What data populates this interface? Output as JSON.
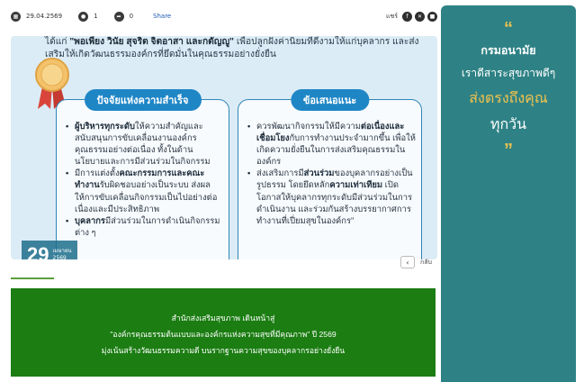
{
  "meta": {
    "date": "29.04.2569",
    "comments": "1",
    "shares": "0",
    "share_label": "Share",
    "share_right_label": "แชร์"
  },
  "infographic": {
    "title_prefix": "ได้แก่ ",
    "title_bold": "\"พอเพียง วินัย สุจริต จิตอาสา และกตัญญู\"",
    "title_rest": " เพื่อปลูกฝังค่านิยมที่ดีงามให้แก่บุคลากร และส่งเสริมให้เกิดวัฒนธรรมองค์กรที่ยึดมั่นในคุณธรรมอย่างยั่งยืน",
    "left_heading": "ปัจจัยแห่งความสำเร็จ",
    "left_items": [
      {
        "bold": "ผู้บริหารทุกระดับ",
        "text": "ให้ความสำคัญและสนับสนุนการขับเคลื่อนงานองค์กรคุณธรรมอย่างต่อเนื่อง ทั้งในด้านนโยบายและการมีส่วนร่วมในกิจกรรม"
      },
      {
        "pre": "มีการแต่งตั้ง",
        "bold": "คณะกรรมการและคณะทำงาน",
        "text": "รับผิดชอบอย่างเป็นระบบ ส่งผลให้การขับเคลื่อนกิจกรรมเป็นไปอย่างต่อเนื่องและมีประสิทธิภาพ"
      },
      {
        "bold": "บุคลากร",
        "text": "มีส่วนร่วมในการดำเนินกิจกรรมต่าง ๆ"
      }
    ],
    "right_heading": "ข้อเสนอแนะ",
    "right_items": [
      {
        "pre": "ควรพัฒนากิจกรรมให้มีความ",
        "bold": "ต่อเนื่องและเชื่อมโยง",
        "text": "กับการทำงานประจำมากขึ้น เพื่อให้เกิดความยั่งยืนในการส่งเสริมคุณธรรมในองค์กร"
      },
      {
        "pre": "ส่งเสริมการมี",
        "bold": "ส่วนร่วม",
        "text": "ของบุคลากรอย่างเป็นรูปธรรม โดยยึดหลัก",
        "bold2": "ความเท่าเทียม",
        "text2": " เปิดโอกาสให้บุคลากรทุกระดับมีส่วนร่วมในการดำเนินงาน และร่วมกันสร้างบรรยากาศการทำงานที่เปี่ยมสุขในองค์กร\""
      }
    ],
    "badge_day": "29",
    "badge_month": "เมษายน",
    "badge_year": "2569"
  },
  "nav": {
    "prev_icon": "chevron-left-icon",
    "back_label": "กลับ"
  },
  "banner": {
    "line1": "สำนักส่งเสริมสุขภาพ เดินหน้าสู่",
    "line2": "\"องค์กรคุณธรรมต้นแบบและองค์กรแห่งความสุขที่มีคุณภาพ\" ปี 2569",
    "line3": "มุ่งเน้นสร้างวัฒนธรรมความดี บนรากฐานความสุขของบุคลากรอย่างยั่งยืน"
  },
  "side": {
    "quote_open": "“",
    "org": "กรมอนามัย",
    "slogan1": "เราดีสาระสุขภาพดีๆ",
    "slogan2": "ส่งตรงถึงคุณ",
    "slogan3": "ทุกวัน",
    "quote_close": "”"
  },
  "colors": {
    "banner_green": "#1b7d12",
    "side_teal": "#2e8285",
    "accent_gold": "#f1c24d",
    "panel_blue": "#1f86c6"
  }
}
